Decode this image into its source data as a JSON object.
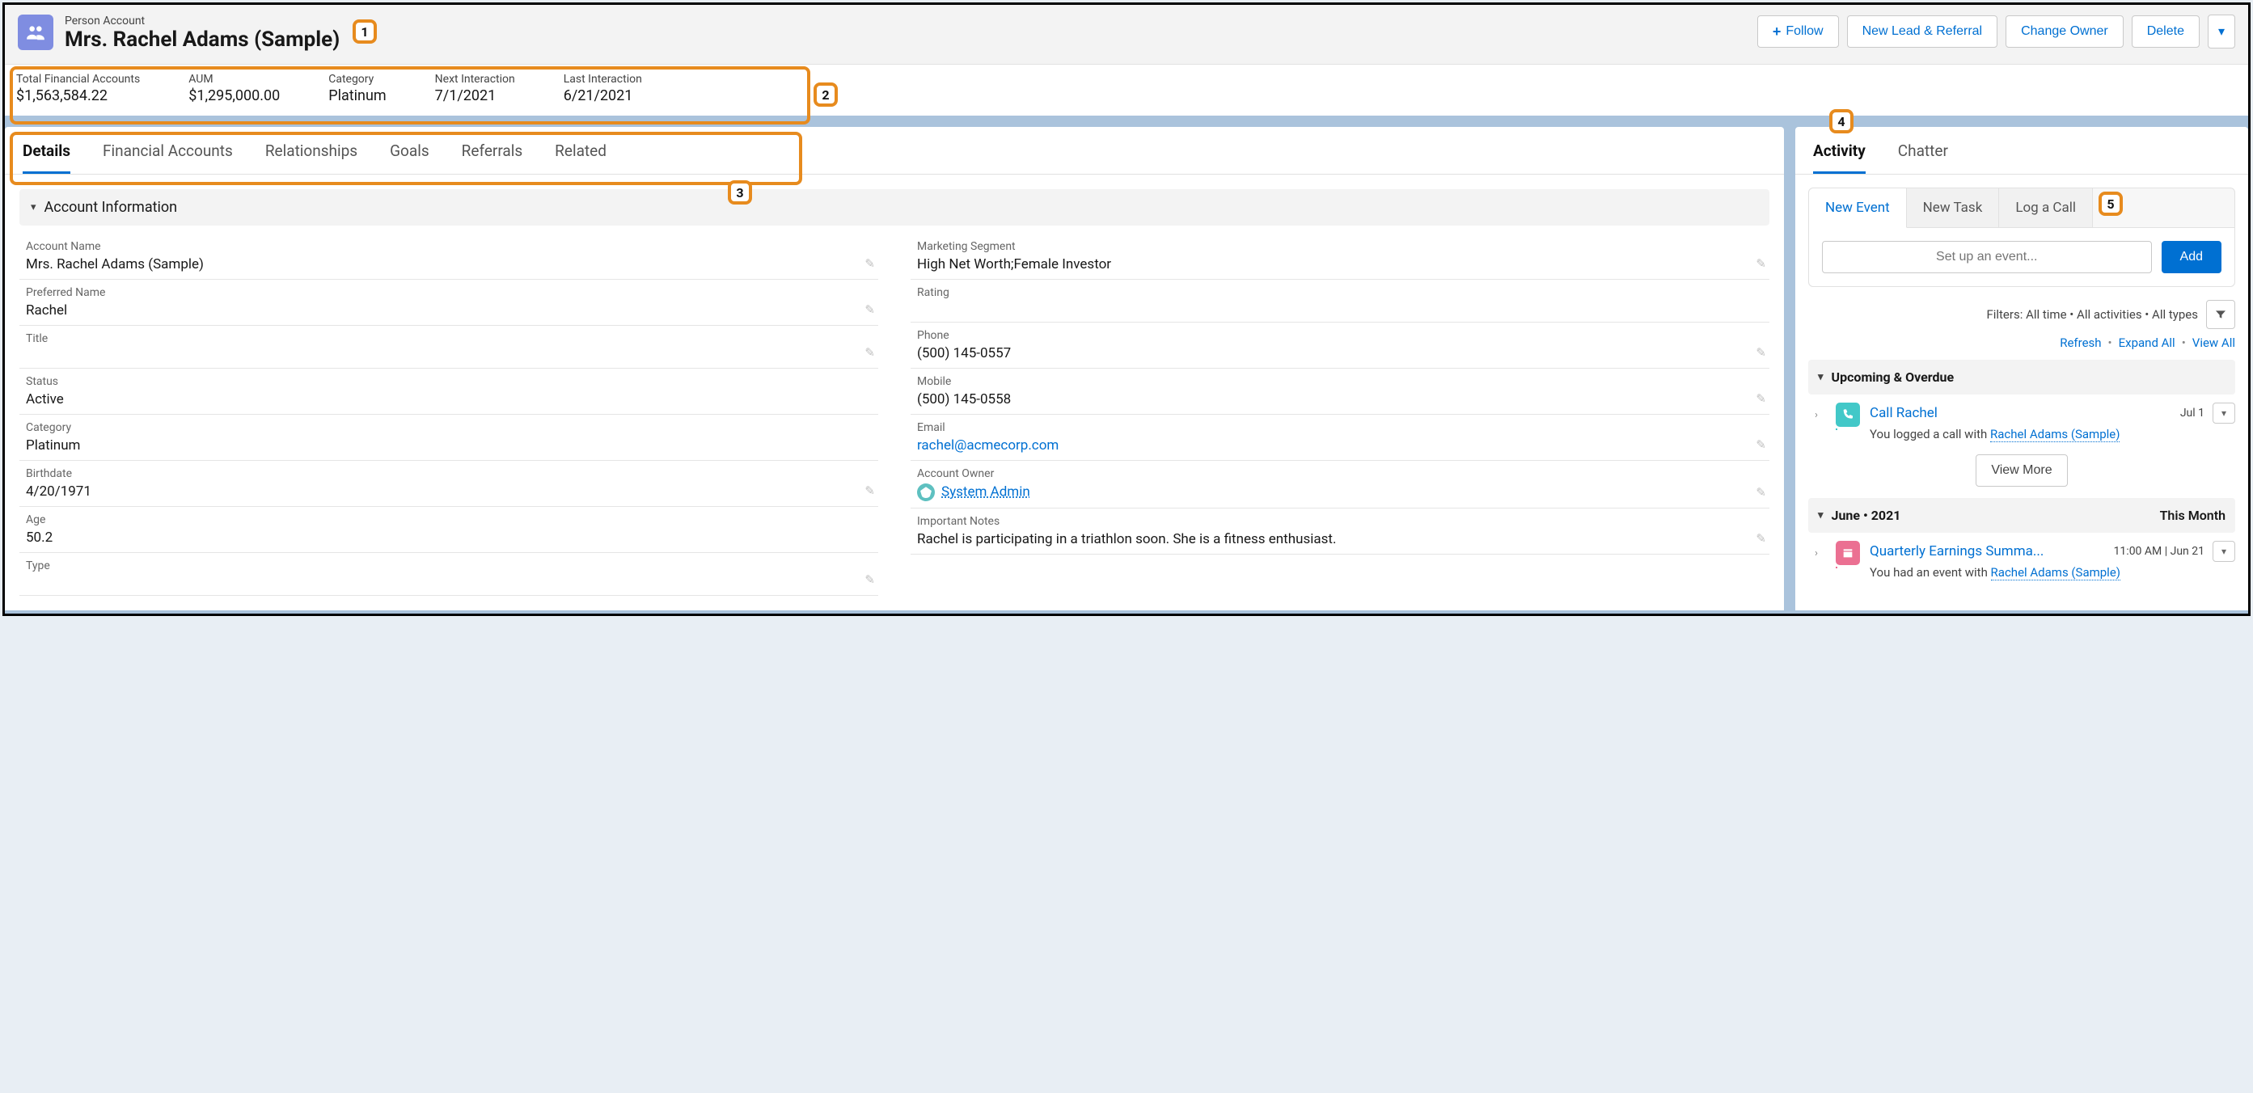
{
  "callouts": {
    "c1": "1",
    "c2": "2",
    "c3": "3",
    "c4": "4",
    "c5": "5"
  },
  "header": {
    "eyebrow": "Person Account",
    "name": "Mrs. Rachel Adams (Sample)",
    "actions": {
      "follow": "Follow",
      "new_lead": "New Lead & Referral",
      "change_owner": "Change Owner",
      "delete": "Delete"
    }
  },
  "kpis": [
    {
      "label": "Total Financial Accounts",
      "value": "$1,563,584.22"
    },
    {
      "label": "AUM",
      "value": "$1,295,000.00"
    },
    {
      "label": "Category",
      "value": "Platinum"
    },
    {
      "label": "Next Interaction",
      "value": "7/1/2021"
    },
    {
      "label": "Last Interaction",
      "value": "6/21/2021"
    }
  ],
  "left_tabs": [
    "Details",
    "Financial Accounts",
    "Relationships",
    "Goals",
    "Referrals",
    "Related"
  ],
  "section_title": "Account Information",
  "fields_left": [
    {
      "label": "Account Name",
      "value": "Mrs. Rachel Adams (Sample)"
    },
    {
      "label": "Preferred Name",
      "value": "Rachel"
    },
    {
      "label": "Title",
      "value": ""
    },
    {
      "label": "Status",
      "value": "Active"
    },
    {
      "label": "Category",
      "value": "Platinum"
    },
    {
      "label": "Birthdate",
      "value": "4/20/1971"
    },
    {
      "label": "Age",
      "value": "50.2"
    },
    {
      "label": "Type",
      "value": ""
    }
  ],
  "fields_right": [
    {
      "label": "Marketing Segment",
      "value": "High Net Worth;Female Investor"
    },
    {
      "label": "Rating",
      "value": ""
    },
    {
      "label": "Phone",
      "value": "(500) 145-0557"
    },
    {
      "label": "Mobile",
      "value": "(500) 145-0558"
    },
    {
      "label": "Email",
      "value": "rachel@acmecorp.com",
      "link": true
    },
    {
      "label": "Account Owner",
      "value": "System Admin",
      "owner": true
    },
    {
      "label": "Important Notes",
      "value": "Rachel is participating in a triathlon soon. She is a fitness enthusiast."
    }
  ],
  "right_tabs": [
    "Activity",
    "Chatter"
  ],
  "activity": {
    "tabs": [
      "New Event",
      "New Task",
      "Log a Call"
    ],
    "placeholder": "Set up an event...",
    "add": "Add",
    "filters": "Filters: All time • All activities • All types",
    "links": {
      "refresh": "Refresh",
      "expand": "Expand All",
      "view_all": "View All"
    },
    "upcoming_header": "Upcoming & Overdue",
    "view_more": "View More",
    "june_header": "June • 2021",
    "june_right": "This Month",
    "items_upcoming": [
      {
        "title": "Call Rachel",
        "date": "Jul 1",
        "desc_prefix": "You logged a call with ",
        "desc_link": "Rachel Adams (Sample)",
        "icon": "call"
      }
    ],
    "items_june": [
      {
        "title": "Quarterly Earnings Summa...",
        "date": "11:00 AM | Jun 21",
        "desc_prefix": "You had an event with ",
        "desc_link": "Rachel Adams (Sample)",
        "icon": "event"
      }
    ]
  }
}
